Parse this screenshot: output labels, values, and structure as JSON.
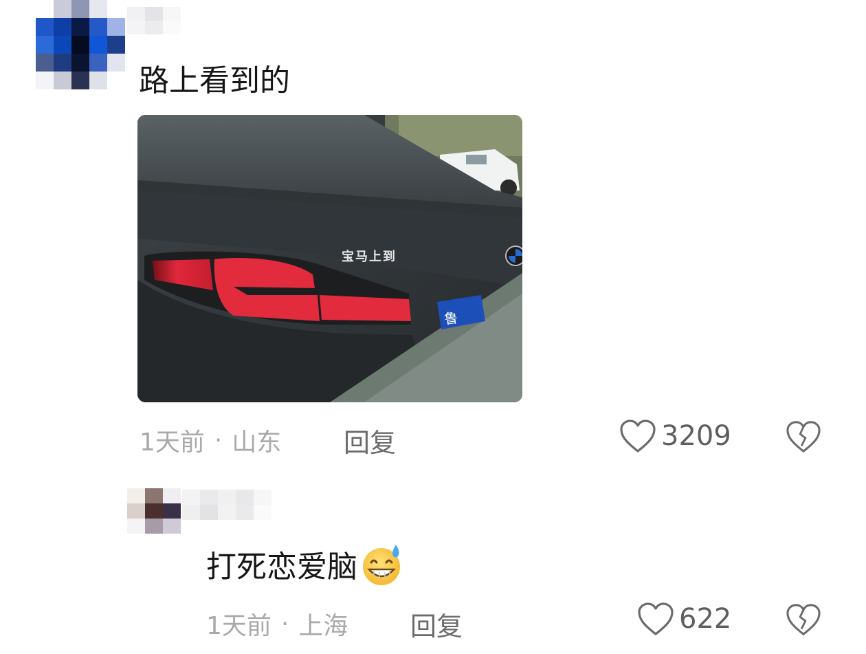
{
  "comments": [
    {
      "text": "路上看到的",
      "photo_badge_text": "宝马上到",
      "photo_plate_text": "鲁",
      "time": "1天前",
      "location": "山东",
      "reply_label": "回复",
      "like_count": "3209"
    },
    {
      "text": "打死恋爱脑",
      "emoji": "grinning-sweat-emoji",
      "time": "1天前",
      "location": "上海",
      "reply_label": "回复",
      "like_count": "622"
    }
  ],
  "icons": {
    "like": "heart-outline-icon",
    "dislike": "broken-heart-icon"
  },
  "colors": {
    "meta_text": "#a9a9a9",
    "reply_text": "#6b6b6b",
    "icon_stroke": "#6b6b6b",
    "taillight": "#e0283a"
  }
}
